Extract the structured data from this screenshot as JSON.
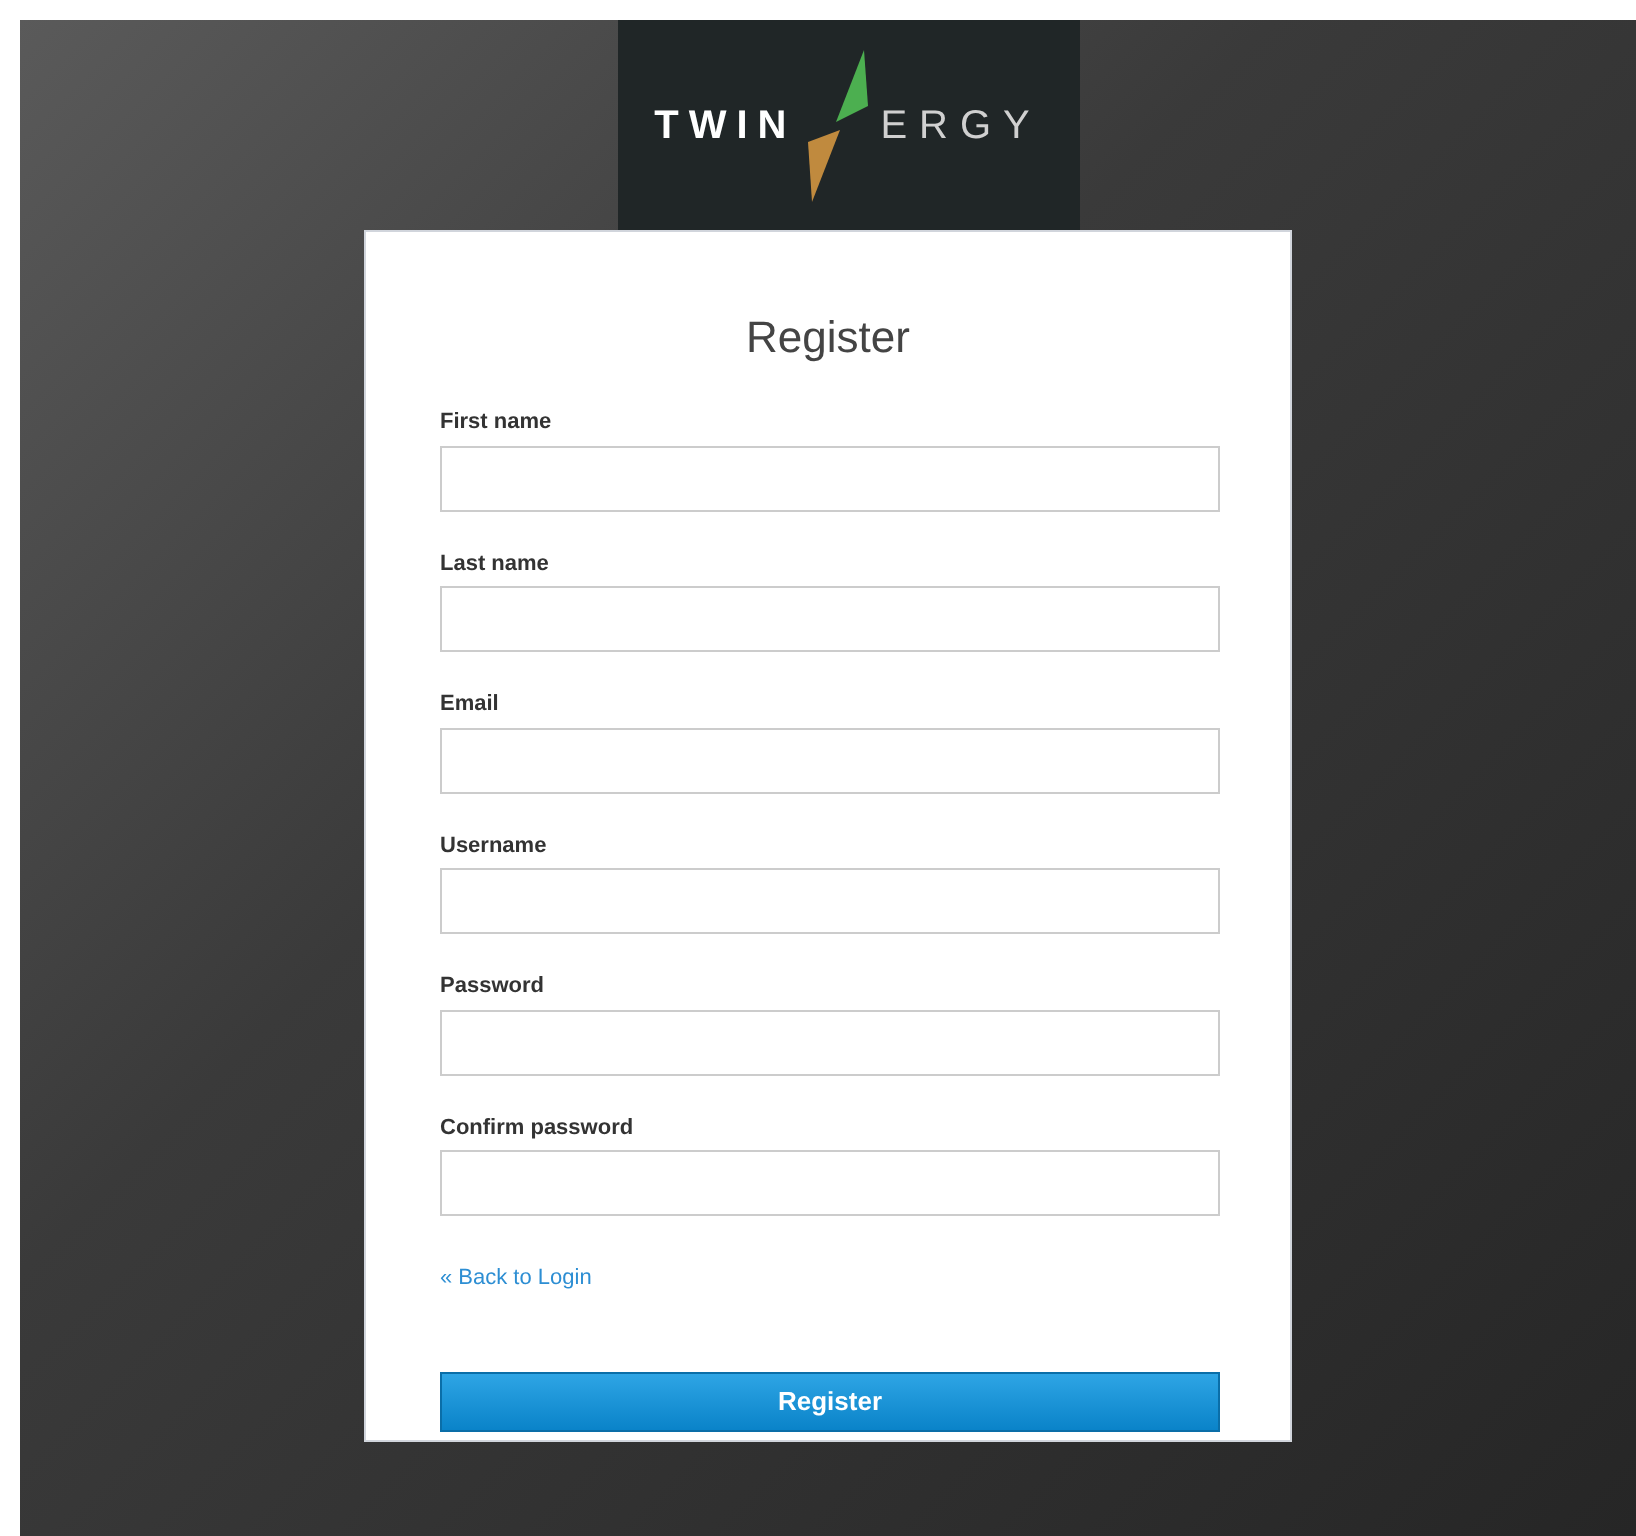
{
  "logo": {
    "left": "TWIN",
    "right": "ERGY"
  },
  "form": {
    "title": "Register",
    "fields": [
      {
        "label": "First name"
      },
      {
        "label": "Last name"
      },
      {
        "label": "Email"
      },
      {
        "label": "Username"
      },
      {
        "label": "Password"
      },
      {
        "label": "Confirm password"
      }
    ],
    "back_link": "« Back to Login",
    "submit": "Register"
  }
}
